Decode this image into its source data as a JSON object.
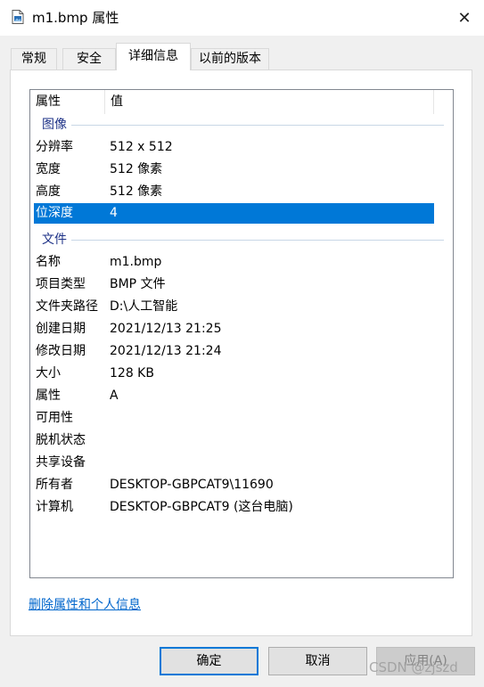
{
  "window": {
    "title": "m1.bmp 属性",
    "close_glyph": "✕"
  },
  "tabs": [
    {
      "label": "常规",
      "active": false
    },
    {
      "label": "安全",
      "active": false
    },
    {
      "label": "详细信息",
      "active": true
    },
    {
      "label": "以前的版本",
      "active": false
    }
  ],
  "list": {
    "headers": {
      "property": "属性",
      "value": "值"
    },
    "groups": [
      {
        "label": "图像",
        "rows": [
          {
            "name": "分辨率",
            "value": "512 x 512"
          },
          {
            "name": "宽度",
            "value": "512 像素"
          },
          {
            "name": "高度",
            "value": "512 像素"
          },
          {
            "name": "位深度",
            "value": "4",
            "selected": true
          }
        ]
      },
      {
        "label": "文件",
        "rows": [
          {
            "name": "名称",
            "value": "m1.bmp"
          },
          {
            "name": "项目类型",
            "value": "BMP 文件"
          },
          {
            "name": "文件夹路径",
            "value": "D:\\人工智能"
          },
          {
            "name": "创建日期",
            "value": "2021/12/13 21:25"
          },
          {
            "name": "修改日期",
            "value": "2021/12/13 21:24"
          },
          {
            "name": "大小",
            "value": "128 KB"
          },
          {
            "name": "属性",
            "value": "A"
          },
          {
            "name": "可用性",
            "value": ""
          },
          {
            "name": "脱机状态",
            "value": ""
          },
          {
            "name": "共享设备",
            "value": ""
          },
          {
            "name": "所有者",
            "value": "DESKTOP-GBPCAT9\\11690"
          },
          {
            "name": "计算机",
            "value": "DESKTOP-GBPCAT9 (这台电脑)"
          }
        ]
      }
    ]
  },
  "link": {
    "label": "删除属性和个人信息"
  },
  "buttons": {
    "ok": "确定",
    "cancel": "取消",
    "apply": "应用(A)"
  },
  "watermark": "CSDN @zjszd",
  "colors": {
    "selection": "#0078d7",
    "group_label": "#1e3287",
    "link": "#0066cc"
  }
}
